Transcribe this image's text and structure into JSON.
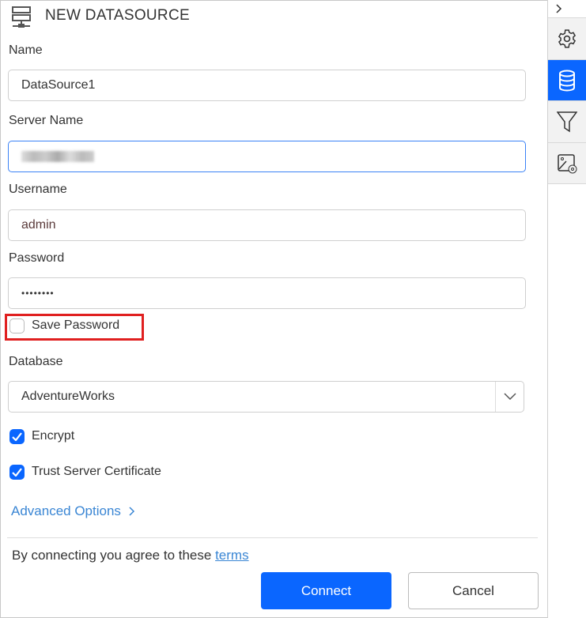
{
  "header": {
    "title": "NEW DATASOURCE",
    "icon": "datasource-icon"
  },
  "form": {
    "name": {
      "label": "Name",
      "value": "DataSource1"
    },
    "server": {
      "label": "Server Name",
      "value": ""
    },
    "username": {
      "label": "Username",
      "value": "admin"
    },
    "password": {
      "label": "Password",
      "value": "••••••••"
    },
    "save_password": {
      "label": "Save Password",
      "checked": false
    },
    "database": {
      "label": "Database",
      "value": "AdventureWorks"
    },
    "encrypt": {
      "label": "Encrypt",
      "checked": true
    },
    "trust": {
      "label": "Trust Server Certificate",
      "checked": true
    },
    "advanced": "Advanced Options"
  },
  "footer": {
    "terms_text": "By connecting you agree to these",
    "terms_link": "terms",
    "connect": "Connect",
    "cancel": "Cancel"
  },
  "sidebar": {
    "items": [
      "collapse-chevron-icon",
      "settings-icon",
      "database-icon",
      "filter-icon",
      "image-settings-icon"
    ],
    "active": "database-icon"
  },
  "colors": {
    "accent": "#0a66ff",
    "link": "#3a86d4",
    "highlight": "#e02020"
  }
}
